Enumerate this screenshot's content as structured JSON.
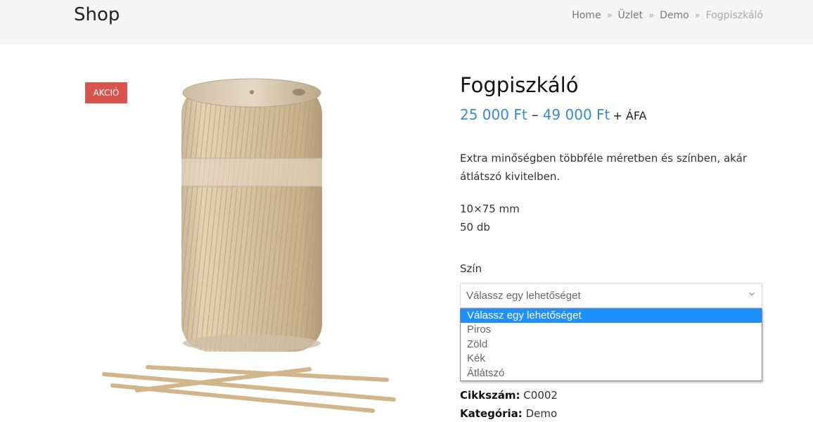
{
  "header": {
    "shop_title": "Shop",
    "breadcrumb": [
      "Home",
      "Üzlet",
      "Demo",
      "Fogpiszkáló"
    ],
    "separator": "»"
  },
  "product": {
    "badge": "AKCIÓ",
    "title": "Fogpiszkáló",
    "price_low": "25 000 Ft",
    "price_dash": "–",
    "price_high": "49 000 Ft",
    "vat": "+ ÁFA",
    "description": "Extra minőségben többféle méretben és színben, akár átlátszó kivitelben.",
    "spec_size": "10×75 mm",
    "spec_qty": "50 db",
    "attribute_label": "Szín",
    "select_placeholder": "Válassz egy lehetőséget",
    "options": [
      "Válassz egy lehetőséget",
      "Piros",
      "Zöld",
      "Kék",
      "Átlátszó"
    ],
    "sku_label": "Cikkszám:",
    "sku": "C0002",
    "category_label": "Kategória:",
    "category": "Demo"
  },
  "colors": {
    "price": "#3a8ad0",
    "badge": "#d9534f",
    "selected_option": "#1e90ff"
  }
}
